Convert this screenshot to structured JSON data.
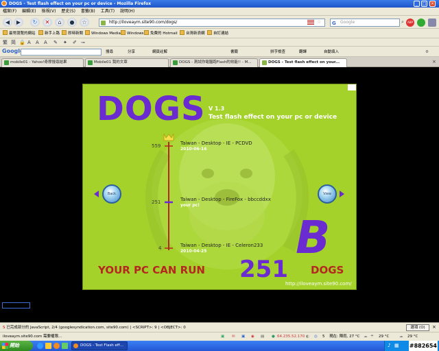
{
  "window": {
    "title": "DOGS - Test flash effect on your pc or device - Mozilla Firefox",
    "controls": [
      "_",
      "□",
      "×"
    ]
  },
  "menu": [
    "檔案(F)",
    "編輯(E)",
    "檢視(V)",
    "歷史(S)",
    "書籤(B)",
    "工具(T)",
    "說明(H)"
  ],
  "nav": {
    "url": "http://iloveaym.site90.com/dogs/",
    "search_placeholder": "Google"
  },
  "bookmarks": [
    "最常瀏覽的網站",
    "新手上路",
    "即時新聞",
    "Windows Media",
    "Windows",
    "免費的 Hotmail",
    "台灣新浪網",
    "自訂連結"
  ],
  "google_toolbar": {
    "logo": "Google",
    "items": [
      "搜尋",
      "分享",
      "網頁註解",
      "書籤",
      "拼字檢查",
      "翻譯",
      "自動填入"
    ]
  },
  "tabs": [
    {
      "label": "mobile01 - Yahoo!奇摩搜尋結果",
      "active": false
    },
    {
      "label": "Mobile01 我的文章",
      "active": false
    },
    {
      "label": "DOGS - 測試你電腦跑Flash的效能!! - M...",
      "active": false
    },
    {
      "label": "DOGS - Test flash effect on your...",
      "active": true
    }
  ],
  "flash": {
    "title": "DOGS",
    "version": "V 1.3",
    "subtitle": "Test flash effect on your pc or device",
    "scale": {
      "max": 559,
      "mid": 251,
      "min": 4,
      "entries": [
        {
          "value": 559,
          "desc": "Taiwan - Desktop - IE - PCDVD",
          "date": "2010-06-16"
        },
        {
          "value": 251,
          "desc": "Taiwan - Desktop - FireFox - bbccddxx",
          "date": "your pc!"
        },
        {
          "value": 4,
          "desc": "Taiwan - Desktop - IE - Celeron233",
          "date": "2010-04-25"
        }
      ]
    },
    "back_label": "Back",
    "view_label": "View",
    "grade": "B",
    "tagline": "YOUR PC CAN RUN",
    "score": "251",
    "unit": "DOGS",
    "site": "http://iloveaym.site90.com/"
  },
  "small_button": "",
  "status": {
    "message": "已完成部分的 JavaScript, 2/4 (googlesyndication.com, site90.com) | <SCRIPT>: 9 | <OBJECT>: 0",
    "button": "選項 (O)",
    "bottom_left": "iloveaym.site90.com 需要權限...",
    "ip": "64.235.52.170",
    "weather1": "現在: 陣雨, 27 °C",
    "weather2": "29 °C",
    "weather3": "29 °C"
  },
  "taskbar": {
    "start": "開始",
    "item": "DOGS - Test Flash eff...",
    "clock": "#882654"
  }
}
